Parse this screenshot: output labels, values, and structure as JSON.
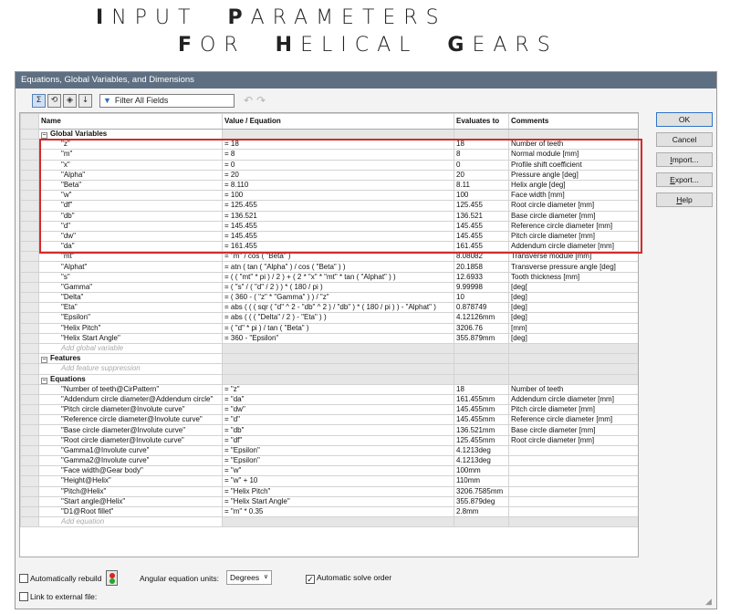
{
  "hero": {
    "line1": [
      {
        "first": "I",
        "rest": "NPUT"
      },
      {
        "first": "P",
        "rest": "ARAMETERS"
      }
    ],
    "line2": [
      {
        "first": "F",
        "rest": "OR"
      },
      {
        "first": "H",
        "rest": "ELICAL"
      },
      {
        "first": "G",
        "rest": "EARS"
      }
    ]
  },
  "dialog": {
    "title": "Equations, Global Variables, and Dimensions",
    "toolbar": {
      "filter_label": "Filter All Fields",
      "icons": [
        "equation-view-icon",
        "sketch-equation-view-icon",
        "dimension-view-icon",
        "ordered-view-icon"
      ]
    },
    "columns": {
      "name": "Name",
      "value": "Value / Equation",
      "evaluates": "Evaluates to",
      "comments": "Comments"
    },
    "sections": {
      "global": "Global Variables",
      "features": "Features",
      "equations": "Equations"
    },
    "global_rows": [
      {
        "name": "\"z\"",
        "value": "= 18",
        "evaluates": "18",
        "comment": "Number of teeth"
      },
      {
        "name": "\"m\"",
        "value": "= 8",
        "evaluates": "8",
        "comment": "Normal module [mm]"
      },
      {
        "name": "\"x\"",
        "value": "= 0",
        "evaluates": "0",
        "comment": "Profile shift coefficient"
      },
      {
        "name": "\"Alpha\"",
        "value": "= 20",
        "evaluates": "20",
        "comment": "Pressure angle [deg]"
      },
      {
        "name": "\"Beta\"",
        "value": "= 8.110",
        "evaluates": "8.11",
        "comment": "Helix angle [deg]"
      },
      {
        "name": "\"w\"",
        "value": "= 100",
        "evaluates": "100",
        "comment": "Face width [mm]"
      },
      {
        "name": "\"df\"",
        "value": "= 125.455",
        "evaluates": "125.455",
        "comment": "Root circle diameter [mm]"
      },
      {
        "name": "\"db\"",
        "value": "= 136.521",
        "evaluates": "136.521",
        "comment": "Base circle diameter [mm]"
      },
      {
        "name": "\"d\"",
        "value": "= 145.455",
        "evaluates": "145.455",
        "comment": "Reference circle diameter [mm]"
      },
      {
        "name": "\"dw\"",
        "value": "= 145.455",
        "evaluates": "145.455",
        "comment": "Pitch circle diameter [mm]"
      },
      {
        "name": "\"da\"",
        "value": "= 161.455",
        "evaluates": "161.455",
        "comment": "Addendum circle diameter [mm]"
      },
      {
        "name": "\"mt\"",
        "value": "= \"m\" / cos ( \"Beta\" )",
        "evaluates": "8.08082",
        "comment": "Transverse module [mm]"
      },
      {
        "name": "\"Alphat\"",
        "value": "= atn ( tan ( \"Alpha\" ) / cos ( \"Beta\" ) )",
        "evaluates": "20.1858",
        "comment": "Transverse pressure angle [deg]"
      },
      {
        "name": "\"s\"",
        "value": "= ( ( \"mt\" * pi ) / 2 ) + ( 2 * \"x\" * \"mt\" * tan ( \"Alphat\" ) )",
        "evaluates": "12.6933",
        "comment": "Tooth thickness [mm]"
      },
      {
        "name": "\"Gamma\"",
        "value": "= ( \"s\" / ( \"d\" / 2 ) ) * ( 180 / pi )",
        "evaluates": "9.99998",
        "comment": "[deg["
      },
      {
        "name": "\"Delta\"",
        "value": "= ( 360 - ( \"z\" * \"Gamma\" ) ) / \"z\"",
        "evaluates": "10",
        "comment": "[deg]"
      },
      {
        "name": "\"Eta\"",
        "value": "= abs ( ( ( sqr ( \"d\" ^ 2 - \"db\" ^ 2 ) / \"db\" ) * ( 180 / pi ) ) - \"Alphat\" )",
        "evaluates": "0.878749",
        "comment": "[deg]"
      },
      {
        "name": "\"Epsilon\"",
        "value": "= abs ( ( ( \"Delta\" / 2 ) - \"Eta\" ) )",
        "evaluates": "4.12126mm",
        "comment": "[deg]"
      },
      {
        "name": "\"Helix Pitch\"",
        "value": "= ( \"d\" * pi ) / tan ( \"Beta\" )",
        "evaluates": "3206.76",
        "comment": "[mm]"
      },
      {
        "name": "\"Helix Start Angle\"",
        "value": "= 360 - \"Epsilon\"",
        "evaluates": "355.879mm",
        "comment": "[deg]"
      }
    ],
    "global_add": "Add global variable",
    "feature_add": "Add feature suppression",
    "equation_rows": [
      {
        "name": "\"Number of teeth@CirPattern\"",
        "value": "= \"z\"",
        "evaluates": "18",
        "comment": "Number of teeth"
      },
      {
        "name": "\"Addendum circle diameter@Addendum circle\"",
        "value": "= \"da\"",
        "evaluates": "161.455mm",
        "comment": "Addendum circle diameter [mm]"
      },
      {
        "name": "\"Pitch circle diameter@Involute curve\"",
        "value": "= \"dw\"",
        "evaluates": "145.455mm",
        "comment": "Pitch circle diameter [mm]"
      },
      {
        "name": "\"Reference circle diameter@Involute curve\"",
        "value": "= \"d\"",
        "evaluates": "145.455mm",
        "comment": "Reference circle diameter [mm]"
      },
      {
        "name": "\"Base circle diameter@Involute curve\"",
        "value": "= \"db\"",
        "evaluates": "136.521mm",
        "comment": "Base circle diameter [mm]"
      },
      {
        "name": "\"Root circle diameter@Involute curve\"",
        "value": "= \"df\"",
        "evaluates": "125.455mm",
        "comment": "Root circle diameter [mm]"
      },
      {
        "name": "\"Gamma1@Involute curve\"",
        "value": "= \"Epsilon\"",
        "evaluates": "4.1213deg",
        "comment": ""
      },
      {
        "name": "\"Gamma2@Involute curve\"",
        "value": "= \"Epsilon\"",
        "evaluates": "4.1213deg",
        "comment": ""
      },
      {
        "name": "\"Face width@Gear body\"",
        "value": "= \"w\"",
        "evaluates": "100mm",
        "comment": ""
      },
      {
        "name": "\"Height@Helix\"",
        "value": "= \"w\" + 10",
        "evaluates": "110mm",
        "comment": ""
      },
      {
        "name": "\"Pitch@Helix\"",
        "value": "= \"Helix Pitch\"",
        "evaluates": "3206.7585mm",
        "comment": ""
      },
      {
        "name": "\"Start angle@Helix\"",
        "value": "= \"Helix Start Angle\"",
        "evaluates": "355.879deg",
        "comment": ""
      },
      {
        "name": "\"D1@Root fillet\"",
        "value": "= \"m\" * 0.35",
        "evaluates": "2.8mm",
        "comment": ""
      }
    ],
    "equation_add": "Add equation",
    "buttons": {
      "ok": "OK",
      "cancel": "Cancel",
      "import_u": "I",
      "import_rest": "mport...",
      "export_u": "E",
      "export_rest": "xport...",
      "help_u": "H",
      "help_rest": "elp"
    },
    "bottom": {
      "auto_rebuild": "Automatically rebuild",
      "angular_label": "Angular equation units:",
      "angular_value": "Degrees",
      "auto_solve": "Automatic solve order",
      "link_external": "Link to external file:"
    },
    "highlight_color": "#d52a2a"
  }
}
